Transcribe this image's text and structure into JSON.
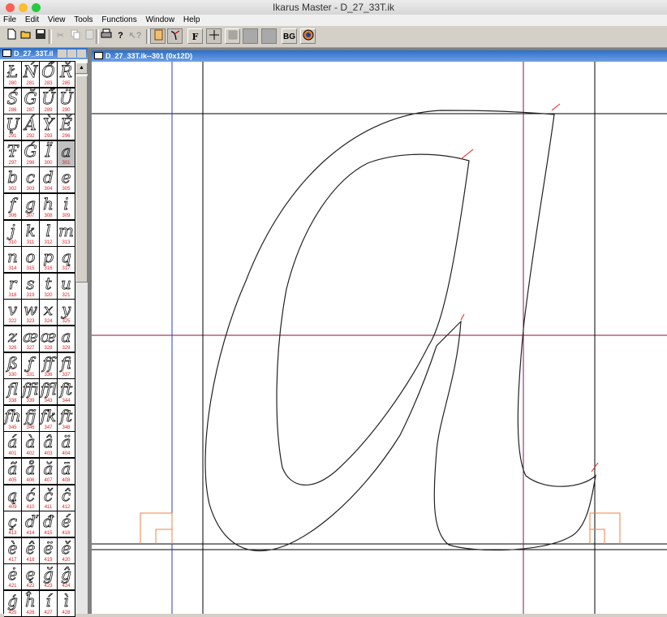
{
  "window": {
    "title": "Ikarus Master - D_27_33T.ik",
    "traffic_colors": {
      "close": "#fc5f57",
      "minimize": "#fdbd2e",
      "zoom": "#28c840"
    }
  },
  "menu": [
    {
      "label": "File"
    },
    {
      "label": "Edit"
    },
    {
      "label": "View"
    },
    {
      "label": "Tools"
    },
    {
      "label": "Functions"
    },
    {
      "label": "Window"
    },
    {
      "label": "Help"
    }
  ],
  "toolbar": {
    "bg_button_label": "BG",
    "font_button_label": "F"
  },
  "glyph_panel": {
    "title": "D_27_33T.il",
    "selected_code": "301",
    "cells": [
      {
        "g": "Ł",
        "n": "280"
      },
      {
        "g": "Ń",
        "n": "281"
      },
      {
        "g": "Ő",
        "n": "283"
      },
      {
        "g": "Ř",
        "n": "285"
      },
      {
        "g": "Ś",
        "n": "286"
      },
      {
        "g": "Ğ",
        "n": "287"
      },
      {
        "g": "Ű",
        "n": "289"
      },
      {
        "g": "Ü",
        "n": "290"
      },
      {
        "g": "Ų",
        "n": "291"
      },
      {
        "g": "Á",
        "n": "292"
      },
      {
        "g": "Ỳ",
        "n": "293"
      },
      {
        "g": "Ě",
        "n": "296"
      },
      {
        "g": "Ŧ",
        "n": "297"
      },
      {
        "g": "Ǵ",
        "n": "298"
      },
      {
        "g": "Ï",
        "n": "300"
      },
      {
        "g": "a",
        "n": "301"
      },
      {
        "g": "b",
        "n": "302"
      },
      {
        "g": "c",
        "n": "303"
      },
      {
        "g": "d",
        "n": "304"
      },
      {
        "g": "e",
        "n": "305"
      },
      {
        "g": "f",
        "n": "306"
      },
      {
        "g": "g",
        "n": "307"
      },
      {
        "g": "h",
        "n": "308"
      },
      {
        "g": "i",
        "n": "309"
      },
      {
        "g": "j",
        "n": "310"
      },
      {
        "g": "k",
        "n": "311"
      },
      {
        "g": "l",
        "n": "312"
      },
      {
        "g": "m",
        "n": "313"
      },
      {
        "g": "n",
        "n": "314"
      },
      {
        "g": "o",
        "n": "315"
      },
      {
        "g": "p",
        "n": "316"
      },
      {
        "g": "q",
        "n": "317"
      },
      {
        "g": "r",
        "n": "318"
      },
      {
        "g": "s",
        "n": "319"
      },
      {
        "g": "t",
        "n": "320"
      },
      {
        "g": "u",
        "n": "321"
      },
      {
        "g": "v",
        "n": "322"
      },
      {
        "g": "w",
        "n": "323"
      },
      {
        "g": "x",
        "n": "324"
      },
      {
        "g": "y",
        "n": "325"
      },
      {
        "g": "z",
        "n": "326"
      },
      {
        "g": "æ",
        "n": "327"
      },
      {
        "g": "œ",
        "n": "328"
      },
      {
        "g": "a",
        "n": "329"
      },
      {
        "g": "ß",
        "n": "330"
      },
      {
        "g": "ƒ",
        "n": "331"
      },
      {
        "g": "ff",
        "n": "336"
      },
      {
        "g": "fi",
        "n": "337"
      },
      {
        "g": "fl",
        "n": "338"
      },
      {
        "g": "ffi",
        "n": "339"
      },
      {
        "g": "ffl",
        "n": "343"
      },
      {
        "g": "ft",
        "n": "344"
      },
      {
        "g": "fh",
        "n": "345"
      },
      {
        "g": "fj",
        "n": "346"
      },
      {
        "g": "fk",
        "n": "347"
      },
      {
        "g": "ft",
        "n": "348"
      },
      {
        "g": "á",
        "n": "401"
      },
      {
        "g": "à",
        "n": "402"
      },
      {
        "g": "â",
        "n": "403"
      },
      {
        "g": "ä",
        "n": "404"
      },
      {
        "g": "ã",
        "n": "405"
      },
      {
        "g": "å",
        "n": "406"
      },
      {
        "g": "ă",
        "n": "407"
      },
      {
        "g": "ā",
        "n": "408"
      },
      {
        "g": "ą",
        "n": "409"
      },
      {
        "g": "ć",
        "n": "410"
      },
      {
        "g": "č",
        "n": "411"
      },
      {
        "g": "ĉ",
        "n": "412"
      },
      {
        "g": "ç",
        "n": "413"
      },
      {
        "g": "ď",
        "n": "414"
      },
      {
        "g": "đ",
        "n": "415"
      },
      {
        "g": "é",
        "n": "416"
      },
      {
        "g": "è",
        "n": "417"
      },
      {
        "g": "ê",
        "n": "418"
      },
      {
        "g": "ë",
        "n": "419"
      },
      {
        "g": "ě",
        "n": "420"
      },
      {
        "g": "ė",
        "n": "421"
      },
      {
        "g": "ę",
        "n": "422"
      },
      {
        "g": "ğ",
        "n": "423"
      },
      {
        "g": "ĝ",
        "n": "424"
      },
      {
        "g": "ģ",
        "n": "425"
      },
      {
        "g": "ĥ",
        "n": "426"
      },
      {
        "g": "í",
        "n": "427"
      },
      {
        "g": "ì",
        "n": "428"
      }
    ]
  },
  "editor": {
    "title": "D_27_33T.ik--301 (0x12D)"
  }
}
